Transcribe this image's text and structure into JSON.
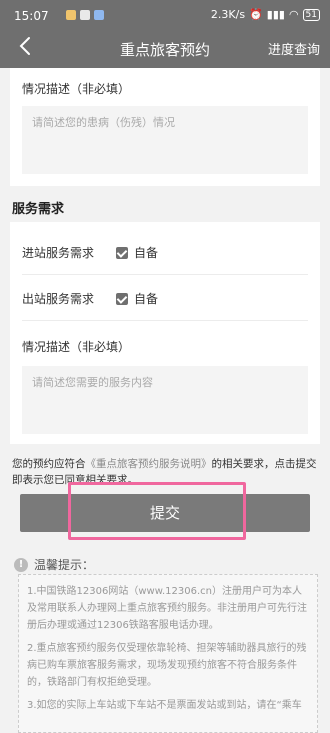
{
  "status_bar": {
    "time": "15:07",
    "network_speed": "2.3K/s",
    "battery": "51"
  },
  "header": {
    "title": "重点旅客预约",
    "progress_link": "进度查询"
  },
  "card1": {
    "label": "情况描述（非必填）",
    "placeholder": "请简述您的患病（伤残）情况"
  },
  "service": {
    "section_title": "服务需求",
    "entry_label": "进站服务需求",
    "exit_label": "出站服务需求",
    "option_label": "自备",
    "desc_label": "情况描述（非必填）",
    "desc_placeholder": "请简述您需要的服务内容"
  },
  "agreement": {
    "prefix": "您的预约应符合",
    "link": "《重点旅客预约服务说明》",
    "suffix": "的相关要求，点击提交即表示您已同意相关要求。"
  },
  "submit_label": "提交",
  "tips": {
    "title": "温馨提示：",
    "items": [
      "1.中国铁路12306网站（www.12306.cn）注册用户可为本人及常用联系人办理网上重点旅客预约服务。非注册用户可先行注册后办理或通过12306铁路客服电话办理。",
      "2.重点旅客预约服务仅受理依靠轮椅、担架等辅助器具旅行的残病已购车票旅客服务需求，现场发现预约旅客不符合服务条件的，铁路部门有权拒绝受理。",
      "3.如您的实际上车站或下车站不是票面发站或到站，请在“乘车"
    ]
  }
}
